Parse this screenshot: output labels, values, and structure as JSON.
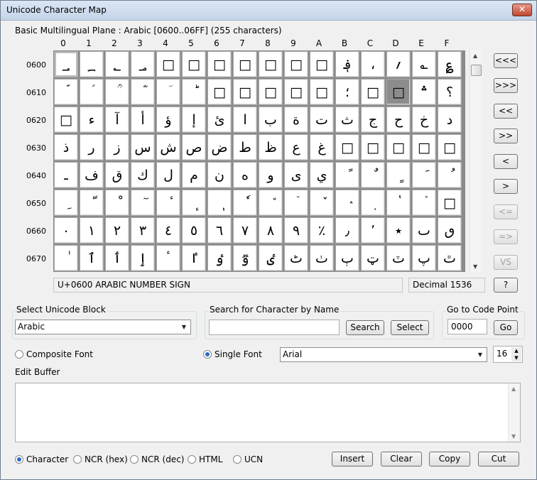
{
  "window": {
    "title": "Unicode Character Map",
    "close_label": "✕"
  },
  "plane_label": "Basic Multilingual Plane : Arabic [0600..06FF] (255 characters)",
  "column_headers": [
    "0",
    "1",
    "2",
    "3",
    "4",
    "5",
    "6",
    "7",
    "8",
    "9",
    "A",
    "B",
    "C",
    "D",
    "E",
    "F"
  ],
  "rows": [
    {
      "label": "0600",
      "cells": [
        "؀",
        "؁",
        "؂",
        "؃",
        "□",
        "□",
        "□",
        "□",
        "□",
        "□",
        "□",
        "؋",
        "،",
        "؍",
        "؎",
        "؏"
      ]
    },
    {
      "label": "0610",
      "cells": [
        "ؐ",
        "ؑ",
        "ؒ",
        "ؓ",
        "ؔ",
        "ؕ",
        "□",
        "□",
        "□",
        "□",
        "□",
        "؛",
        "□",
        "□",
        "؞",
        "؟"
      ]
    },
    {
      "label": "0620",
      "cells": [
        "□",
        "ء",
        "آ",
        "أ",
        "ؤ",
        "إ",
        "ئ",
        "ا",
        "ب",
        "ة",
        "ت",
        "ث",
        "ج",
        "ح",
        "خ",
        "د"
      ]
    },
    {
      "label": "0630",
      "cells": [
        "ذ",
        "ر",
        "ز",
        "س",
        "ش",
        "ص",
        "ض",
        "ط",
        "ظ",
        "ع",
        "غ",
        "□",
        "□",
        "□",
        "□",
        "□"
      ]
    },
    {
      "label": "0640",
      "cells": [
        "ـ",
        "ف",
        "ق",
        "ك",
        "ل",
        "م",
        "ن",
        "ه",
        "و",
        "ى",
        "ي",
        "ً",
        "ٌ",
        "ٍ",
        "َ",
        "ُ"
      ]
    },
    {
      "label": "0650",
      "cells": [
        "ِ",
        "ّ",
        "ْ",
        "ٓ",
        "ٔ",
        "ٕ",
        "ٖ",
        "ٗ",
        "٘",
        "ٙ",
        "ٚ",
        "ٛ",
        "ٜ",
        "ٝ",
        "ٞ",
        "□"
      ]
    },
    {
      "label": "0660",
      "cells": [
        "٠",
        "١",
        "٢",
        "٣",
        "٤",
        "٥",
        "٦",
        "٧",
        "٨",
        "٩",
        "٪",
        "٫",
        "٬",
        "٭",
        "ٮ",
        "ٯ"
      ]
    },
    {
      "label": "0670",
      "cells": [
        "ٰ",
        "ٱ",
        "ٲ",
        "ٳ",
        "ٴ",
        "ٵ",
        "ٶ",
        "ٷ",
        "ٸ",
        "ٹ",
        "ٺ",
        "ٻ",
        "ټ",
        "ٽ",
        "پ",
        "ٿ"
      ]
    }
  ],
  "selected_cell": {
    "row": 0,
    "col": 0
  },
  "highlighted_cell": {
    "row": 1,
    "col": 13
  },
  "nav_buttons": [
    "<<<",
    ">>>",
    "<<",
    ">>",
    "<",
    ">",
    "<=",
    "=>",
    "VS"
  ],
  "nav_disabled": [
    false,
    false,
    false,
    false,
    false,
    false,
    true,
    true,
    true
  ],
  "help_button": "?",
  "status": {
    "name": "U+0600 ARABIC NUMBER SIGN",
    "decimal": "Decimal 1536"
  },
  "block_group": {
    "label": "Select Unicode Block",
    "value": "Arabic"
  },
  "search_group": {
    "label": "Search for Character by Name",
    "value": "",
    "search_button": "Search",
    "select_button": "Select"
  },
  "goto_group": {
    "label": "Go to Code Point",
    "value": "0000",
    "go_button": "Go"
  },
  "font_options": {
    "composite_label": "Composite Font",
    "single_label": "Single Font",
    "selected": "single",
    "font_name": "Arial",
    "font_size": "16"
  },
  "edit_buffer": {
    "label": "Edit Buffer",
    "value": ""
  },
  "output_modes": {
    "options": [
      "Character",
      "NCR (hex)",
      "NCR (dec)",
      "HTML",
      "UCN"
    ],
    "selected": "Character"
  },
  "buffer_buttons": {
    "insert": "Insert",
    "clear": "Clear",
    "copy": "Copy",
    "cut": "Cut"
  }
}
